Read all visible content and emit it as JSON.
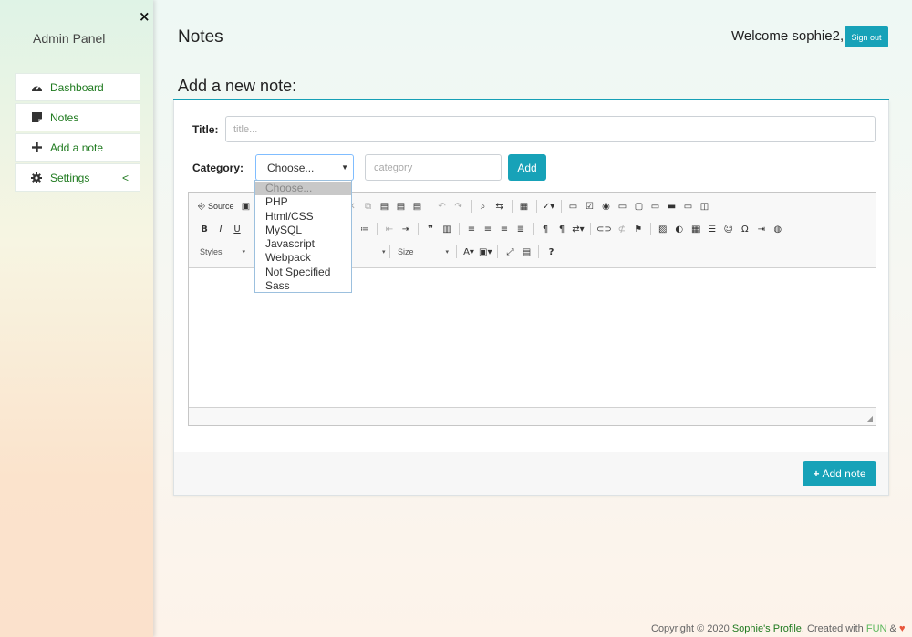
{
  "sidebar": {
    "brand": "Admin Panel",
    "close_icon": "×",
    "items": [
      {
        "label": "Dashboard",
        "icon": "gauge-icon"
      },
      {
        "label": "Notes",
        "icon": "note-icon"
      },
      {
        "label": "Add a note",
        "icon": "plus-icon"
      },
      {
        "label": "Settings",
        "icon": "gear-icon",
        "chevron": "<"
      }
    ]
  },
  "header": {
    "title": "Notes",
    "welcome": "Welcome sophie2,",
    "signout": "Sign out"
  },
  "card": {
    "title": "Add a new note:",
    "title_label": "Title:",
    "title_placeholder": "title...",
    "category_label": "Category:",
    "category_selected": "Choose...",
    "category_placeholder": "category",
    "add_label": "Add",
    "add_note_label": "Add note"
  },
  "editor": {
    "source_label": "Source",
    "styles_label": "Styles",
    "size_label": "Size"
  },
  "dropdown": {
    "options": [
      "Choose...",
      "PHP",
      "Html/CSS",
      "MySQL",
      "Javascript",
      "Webpack",
      "Not Specified",
      "Sass"
    ]
  },
  "footer": {
    "prefix": "Copyright © 2020",
    "site": "Sophie's Profile.",
    "created": "Created with",
    "fun": "FUN",
    "amp": "&"
  },
  "colors": {
    "accent": "#17a2b8",
    "nav_text": "#1f7a1f",
    "heart": "#e8553b"
  }
}
